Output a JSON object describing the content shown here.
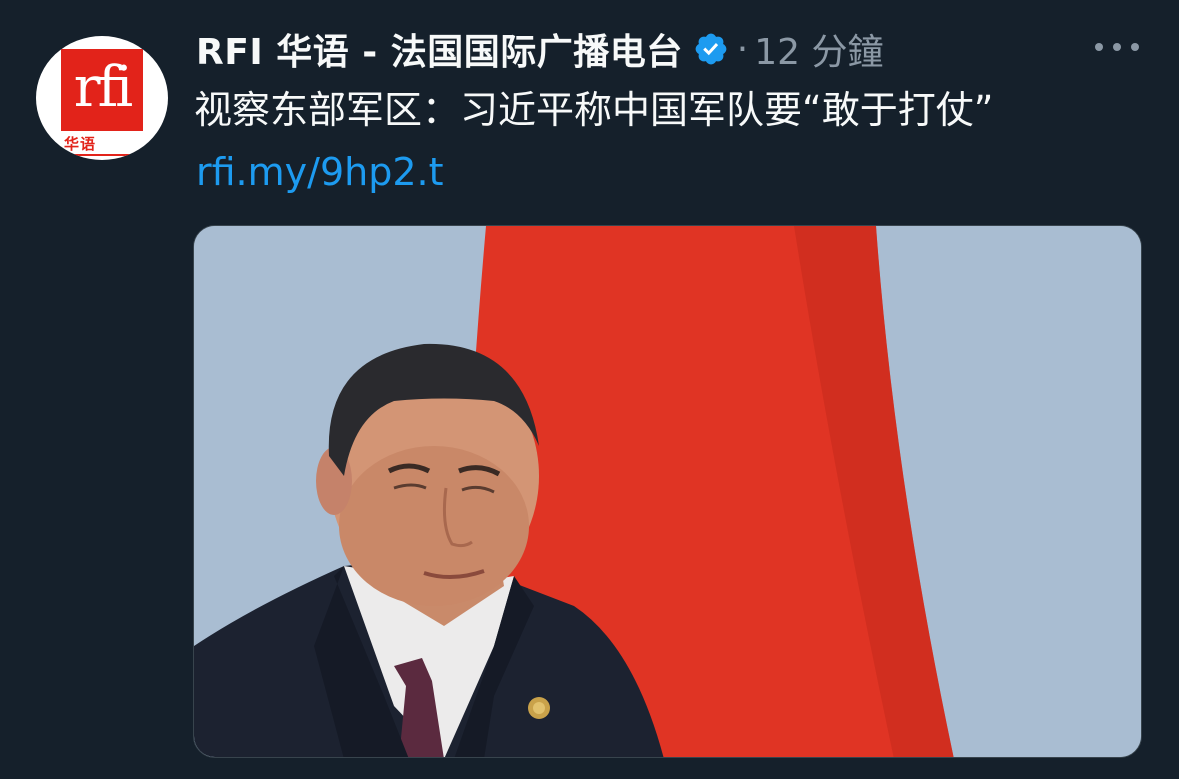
{
  "author": {
    "display_name": "RFI 华语 - 法国国际广播电台",
    "verified": true,
    "avatar": {
      "logo_letters": "rfi",
      "logo_subtitle": "华语",
      "brand_color": "#e2231a"
    }
  },
  "meta": {
    "separator": "·",
    "time": "12 分鐘"
  },
  "tweet": {
    "text": "视察东部军区：习近平称中国军队要“敢于打仗”",
    "link": "rfi.my/9hp2.t"
  },
  "colors": {
    "background": "#15202b",
    "text": "#f7f9f9",
    "secondary": "#8b98a5",
    "link": "#1d9bf0",
    "verified": "#1d9bf0"
  },
  "icons": {
    "verified": "verified-badge-icon",
    "more": "more-horizontal-icon"
  }
}
